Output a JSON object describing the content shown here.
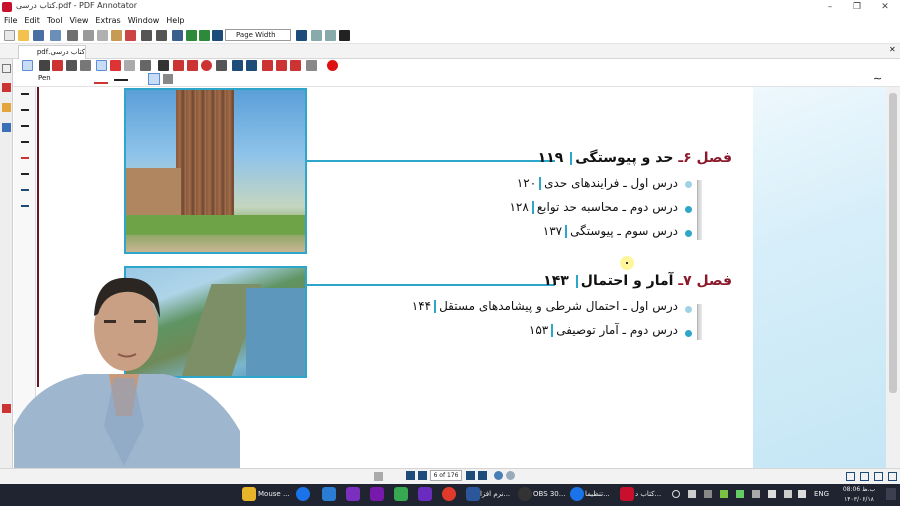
{
  "window": {
    "title": "کتاب درسی.pdf - PDF Annotator",
    "controls": [
      "–",
      "❐",
      "✕"
    ]
  },
  "menu": [
    "File",
    "Edit",
    "Tool",
    "View",
    "Extras",
    "Window",
    "Help"
  ],
  "toolbar": {
    "zoom_mode": "Page Width"
  },
  "tab": {
    "label": "کتاب درسی.pdf"
  },
  "pen_toolbar": {
    "tool_label": "Pen"
  },
  "document": {
    "chapters": [
      {
        "prefix": "فصل ۶ـ",
        "title": "حد و پیوستگی",
        "page": "۱۱۹",
        "lessons": [
          {
            "text": "درس اول ـ فرایندهای حدی",
            "page": "۱۲۰"
          },
          {
            "text": "درس دوم ـ محاسبه حد توابع",
            "page": "۱۲۸"
          },
          {
            "text": "درس سوم ـ پیوستگی",
            "page": "۱۳۷"
          }
        ]
      },
      {
        "prefix": "فصل ۷ـ",
        "title": "آمار و احتمال",
        "page": "۱۴۳",
        "lessons": [
          {
            "text": "درس اول ـ احتمال شرطی و پیشامدهای مستقل",
            "page": "۱۴۴"
          },
          {
            "text": "درس دوم ـ آمار توصیفی",
            "page": "۱۵۳"
          }
        ]
      }
    ]
  },
  "statusbar": {
    "page_indicator": "6 of 176"
  },
  "taskbar": {
    "items": [
      {
        "label": "Mouse ..."
      },
      {
        "label": "نرم افزا..."
      },
      {
        "label": "OBS 30..."
      },
      {
        "label": "تنظیما..."
      },
      {
        "label": "کتاب د..."
      }
    ],
    "language": "ENG",
    "clock_time": "08:06 ب.ظ",
    "clock_date": "۱۴۰۳/۰۶/۱۸"
  },
  "colors": {
    "accent": "#2ea6c9",
    "chapter_prefix": "#8b1a2c",
    "taskbar": "#1f2430"
  }
}
